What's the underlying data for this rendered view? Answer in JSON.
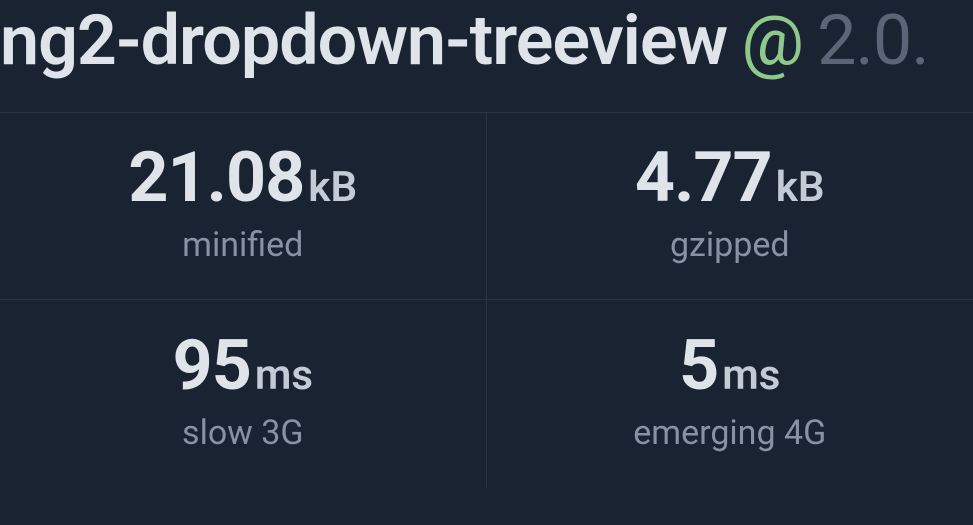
{
  "header": {
    "package_name": "ng2-dropdown-treeview",
    "at": "@",
    "version": "2.0."
  },
  "stats": [
    {
      "value": "21.08",
      "unit": "kB",
      "label": "minified"
    },
    {
      "value": "4.77",
      "unit": "kB",
      "label": "gzipped"
    },
    {
      "value": "95",
      "unit": "ms",
      "label": "slow 3G"
    },
    {
      "value": "5",
      "unit": "ms",
      "label": "emerging 4G"
    }
  ]
}
